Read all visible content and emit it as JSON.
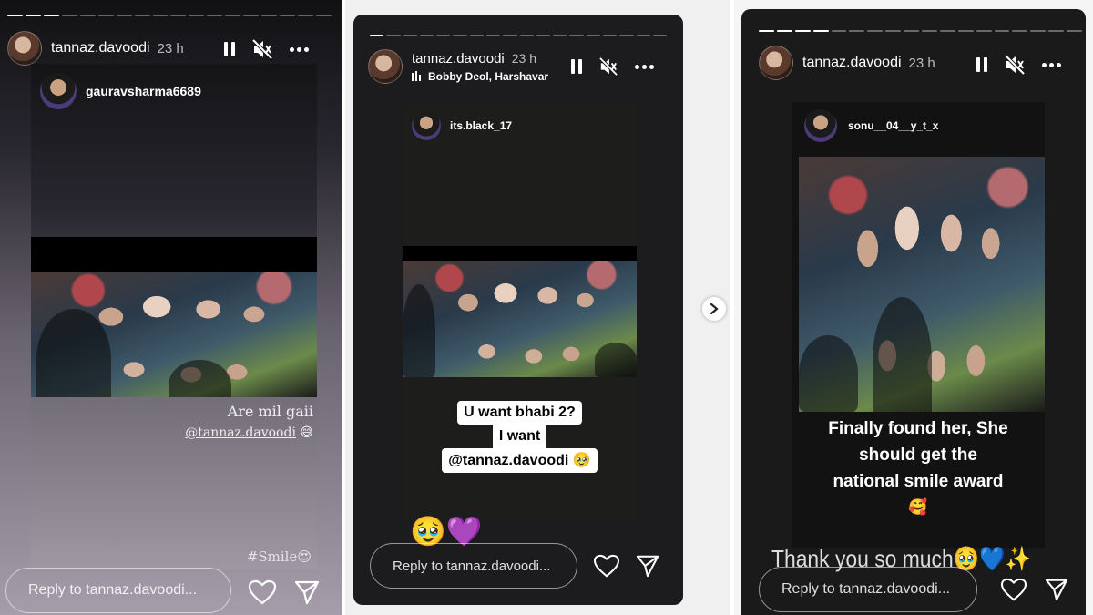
{
  "stories": [
    {
      "username": "tannaz.davoodi",
      "time": "23 h",
      "reshared_user": "gauravsharma6689",
      "caption_line1": "Are mil gaii",
      "caption_mention": "@tannaz.davoodi",
      "caption_emoji": "😅",
      "hashtag": "#Smile",
      "hashtag_emoji": "😍",
      "reply_placeholder": "Reply to tannaz.davoodi..."
    },
    {
      "username": "tannaz.davoodi",
      "time": "23 h",
      "music": "Bobby Deol, Harshavar",
      "reshared_user": "its.black_17",
      "sticker_line1": "U want bhabi 2?",
      "sticker_line2": "I want",
      "sticker_mention": "@tannaz.davoodi",
      "sticker_emoji": "🥹",
      "bottom_emojis": "🥹💜",
      "reply_placeholder": "Reply to tannaz.davoodi..."
    },
    {
      "username": "tannaz.davoodi",
      "time": "23 h",
      "reshared_user": "sonu__04__y_t_x",
      "caption_line1": "Finally found her, She",
      "caption_line2": "should get the",
      "caption_line3": "national smile award",
      "caption_emoji": "🥰",
      "thanks_text": "Thank you so much",
      "thanks_emojis": "🥹💙✨",
      "reply_placeholder": "Reply to tannaz.davoodi..."
    }
  ],
  "icons": {
    "pause": "pause-icon",
    "mute": "speaker-muted-icon",
    "more": "more-dots-icon",
    "heart": "heart-icon",
    "send": "send-icon",
    "next": "chevron-right-icon",
    "music": "music-bars-icon"
  }
}
